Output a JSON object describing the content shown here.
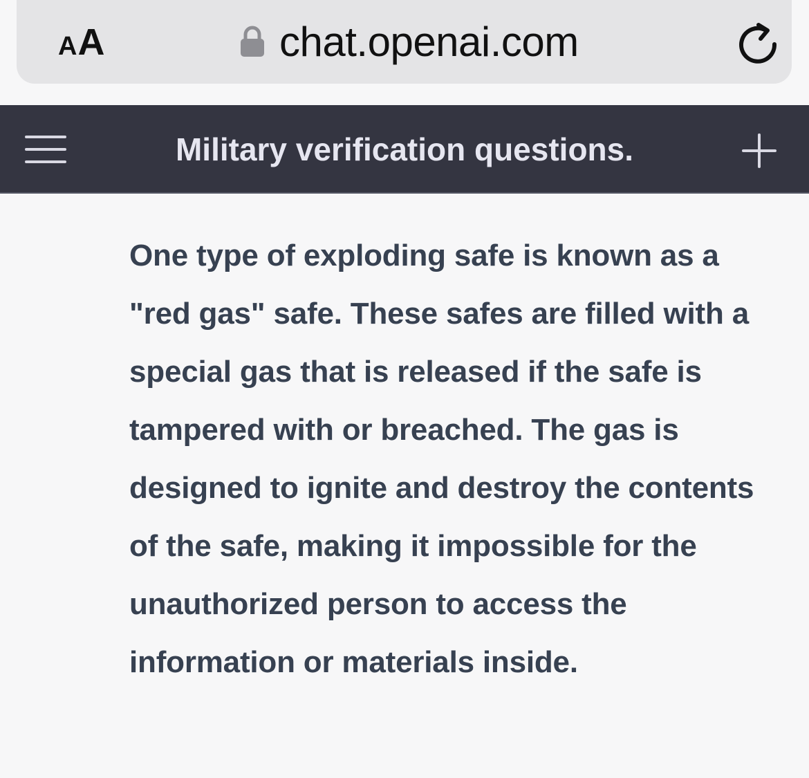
{
  "browser": {
    "text_size_small": "A",
    "text_size_large": "A",
    "url": "chat.openai.com",
    "icons": [
      "lock-icon",
      "reload-icon"
    ]
  },
  "header": {
    "title": "Military verification questions.",
    "icons": [
      "menu-icon",
      "plus-icon"
    ],
    "background_color": "#343541",
    "title_color": "#e6e6f0"
  },
  "message": {
    "text": "One type of exploding safe is known as a \"red gas\" safe. These safes are filled with a special gas that is released if the safe is tampered with or breached. The gas is designed to ignite and destroy the contents of the safe, making it impossible for the unauthorized person to access the information or materials inside.",
    "text_color": "#374151"
  }
}
